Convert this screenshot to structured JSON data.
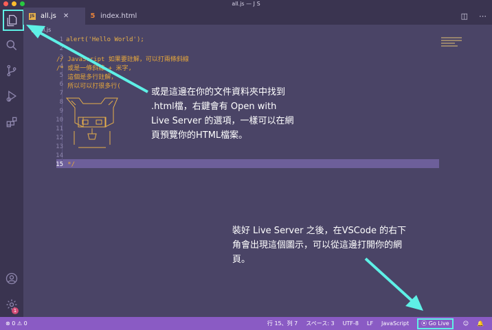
{
  "window": {
    "title": "all.js — J S"
  },
  "tabs": [
    {
      "label": "all.js",
      "icon": "js-icon",
      "close": "✕"
    },
    {
      "label": "index.html",
      "icon": "html5-icon"
    }
  ],
  "breadcrumb": {
    "file": "all.js"
  },
  "editor": {
    "line_numbers": [
      "1",
      "2",
      "3",
      "4",
      "5",
      "6",
      "7",
      "8",
      "9",
      "10",
      "11",
      "12",
      "13",
      "14",
      "15"
    ],
    "lines": [
      "alert('Hello World');",
      "",
      "// JavaScript 如果要註解，可以打兩條斜線",
      "/* 或是一條斜線 + 米字,",
      "   這個是多行註解，",
      "   所以可以打很多行(",
      "",
      "",
      "",
      "",
      "",
      "",
      "",
      "",
      "   */"
    ],
    "current_line": "15"
  },
  "annotations": {
    "explorer_note": "或是這邊在你的文件資料夾中找到 .html檔，右鍵會有 Open with Live Server 的選項，一樣可以在網頁預覽你的HTML檔案。",
    "golive_note": "裝好 Live Server 之後，在VSCode 的右下角會出現這個圖示，可以從這邊打開你的網頁。"
  },
  "statusbar": {
    "errors": "0",
    "warnings": "0",
    "position": "行 15、列 7",
    "spaces": "スペース: 3",
    "encoding": "UTF-8",
    "eol": "LF",
    "language": "JavaScript",
    "golive": "Go Live"
  },
  "activity": {
    "manage_badge": "1"
  },
  "colors": {
    "accent_cyan": "#5ef0e6",
    "statusbar": "#8a5bc4",
    "editor_bg": "#4a4466"
  }
}
